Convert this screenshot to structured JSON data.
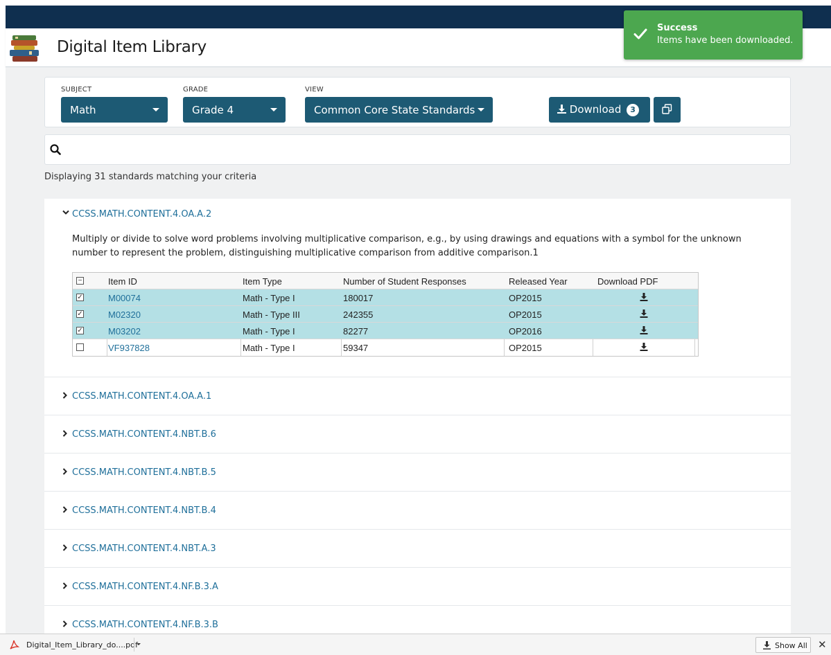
{
  "header": {
    "title": "Digital Item Library"
  },
  "filters": {
    "subject": {
      "label": "SUBJECT",
      "value": "Math"
    },
    "grade": {
      "label": "GRADE",
      "value": "Grade 4"
    },
    "view": {
      "label": "VIEW",
      "value": "Common Core State Standards"
    },
    "download": {
      "label": "Download",
      "count": "3"
    }
  },
  "search": {
    "placeholder": "",
    "value": ""
  },
  "results": {
    "summary": "Displaying 31 standards matching your criteria"
  },
  "standards": [
    {
      "code": "CCSS.MATH.CONTENT.4.OA.A.2",
      "expanded": true,
      "description": "Multiply or divide to solve word problems involving multiplicative comparison, e.g., by using drawings and equations with a symbol for the unknown number to represent the problem, distinguishing multiplicative comparison from additive comparison.1",
      "table": {
        "headers": [
          "Item ID",
          "Item Type",
          "Number of Student Responses",
          "Released Year",
          "Download PDF"
        ],
        "rows": [
          {
            "id": "M00074",
            "type": "Math - Type I",
            "responses": "180017",
            "year": "OP2015",
            "checked": true
          },
          {
            "id": "M02320",
            "type": "Math - Type III",
            "responses": "242355",
            "year": "OP2015",
            "checked": true
          },
          {
            "id": "M03202",
            "type": "Math - Type I",
            "responses": "82277",
            "year": "OP2016",
            "checked": true
          },
          {
            "id": "VF937828",
            "type": "Math - Type I",
            "responses": "59347",
            "year": "OP2015",
            "checked": false
          }
        ]
      }
    },
    {
      "code": "CCSS.MATH.CONTENT.4.OA.A.1"
    },
    {
      "code": "CCSS.MATH.CONTENT.4.NBT.B.6"
    },
    {
      "code": "CCSS.MATH.CONTENT.4.NBT.B.5"
    },
    {
      "code": "CCSS.MATH.CONTENT.4.NBT.B.4"
    },
    {
      "code": "CCSS.MATH.CONTENT.4.NBT.A.3"
    },
    {
      "code": "CCSS.MATH.CONTENT.4.NF.B.3.A"
    },
    {
      "code": "CCSS.MATH.CONTENT.4.NF.B.3.B"
    }
  ],
  "toast": {
    "title": "Success",
    "message": "Items have been downloaded."
  },
  "download_bar": {
    "filename": "Digital_Item_Library_do....pdf",
    "show_all": "Show All"
  },
  "colors": {
    "primary": "#1d5a74",
    "link": "#1f6f9a",
    "selected_row": "#b4e0e5",
    "toast": "#4ca74f",
    "topbar": "#0f2f4f"
  }
}
